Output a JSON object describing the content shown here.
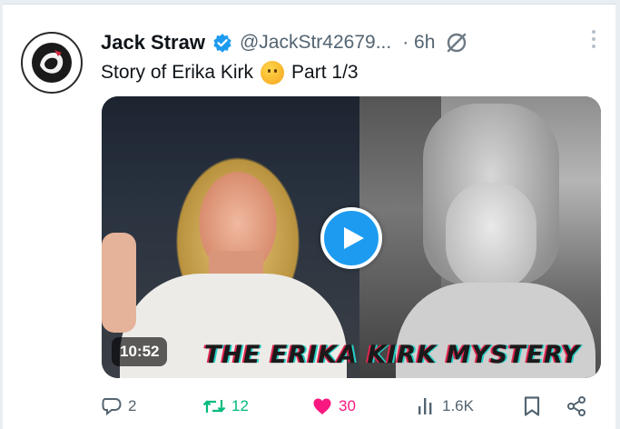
{
  "tweet": {
    "author_name": "Jack Straw",
    "handle": "@JackStr42679...",
    "time": "· 6h",
    "text": "Story of Erika Kirk",
    "text_suffix": "Part 1/3",
    "emoji": "thinking-face-icon"
  },
  "media": {
    "duration": "10:52",
    "overlay_title": "THE ERIKA KIRK MYSTERY",
    "play_icon": "play-icon"
  },
  "actions": {
    "replies": "2",
    "reposts": "12",
    "likes": "30",
    "views": "1.6K"
  },
  "colors": {
    "accent": "#1d9bf0",
    "repost": "#00ba7c",
    "like": "#f91880",
    "muted": "#536471"
  }
}
